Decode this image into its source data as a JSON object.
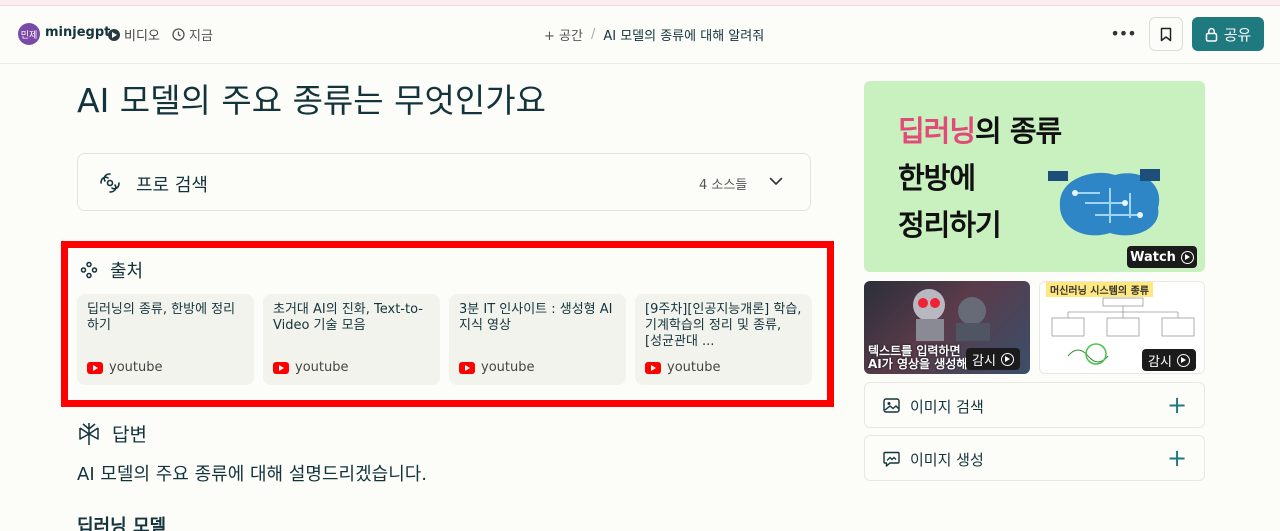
{
  "header": {
    "avatar_text": "민제",
    "username": "minjegpt",
    "video_label": "비디오",
    "time_label": "지금",
    "breadcrumb_space": "+ 공간",
    "breadcrumb_sep": "/",
    "breadcrumb_title": "AI 모델의 종류에 대해 알려줘",
    "more_label": "•••",
    "share_label": "공유"
  },
  "main": {
    "title": "AI 모델의 주요 종류는 무엇인가요",
    "pro_search_label": "프로 검색",
    "pro_search_sources": "4 소스들",
    "sources_title": "출처",
    "sources": [
      {
        "title": "딥러닝의 종류, 한방에 정리하기",
        "site": "youtube"
      },
      {
        "title": "초거대 AI의 진화, Text-to-Video 기술 모음",
        "site": "youtube"
      },
      {
        "title": "3분 IT 인사이트 : 생성형 AI 지식 영상",
        "site": "youtube"
      },
      {
        "title": "[9주차][인공지능개론] 학습, 기계학습의 정리 및 종류, [성균관대 ...",
        "site": "youtube"
      }
    ],
    "answer_title": "답변",
    "answer_text": "AI 모델의 주요 종류에 대해 설명드리겠습니다.",
    "section_heading": "딥러닝 모델"
  },
  "side": {
    "main_video": {
      "line1_pink": "딥러닝",
      "line1_rest": "의 종류",
      "line2": "한방에",
      "line3": "정리하기",
      "watch_label": "Watch"
    },
    "thumbs": [
      {
        "caption_line1": "텍스트를 입력하면",
        "caption_line2": "AI가 영상을 생성해드",
        "button": "감시"
      },
      {
        "caption": "머신러닝 시스템의 종류",
        "button": "감시"
      }
    ],
    "image_search_label": "이미지 검색",
    "image_generate_label": "이미지 생성",
    "plus_label": "+"
  },
  "colors": {
    "accent": "#1f7a80",
    "highlight_frame": "#ff0000",
    "video_bg": "#c9f0bf",
    "youtube_red": "#ff0000"
  }
}
